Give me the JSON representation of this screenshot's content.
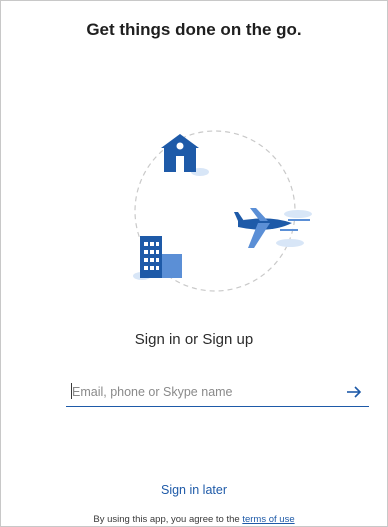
{
  "header": {
    "headline": "Get things done on the go."
  },
  "illustration": {
    "icons": [
      "house-icon",
      "airplane-icon",
      "office-building-icon"
    ],
    "accent_color": "#1e5aa8",
    "light_color": "#5b8fd6",
    "cloud_color": "#d8e6f7"
  },
  "signin": {
    "label": "Sign in or Sign up",
    "input_placeholder": "Email, phone or Skype name",
    "input_value": "",
    "submit_icon": "arrow-right-icon"
  },
  "footer": {
    "sign_in_later": "Sign in later",
    "terms_prefix": "By using this app, you agree to the ",
    "terms_link": "terms of use"
  }
}
